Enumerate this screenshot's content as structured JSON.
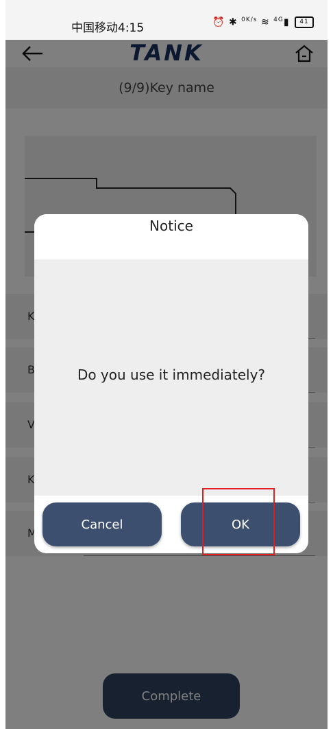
{
  "status_bar": {
    "carrier_time": "中国移动4:15",
    "net_speed_value": "0",
    "net_speed_unit": "K/s",
    "signal": "4G",
    "battery": "41"
  },
  "header": {
    "logo": "TANK",
    "back_icon": "back-arrow-icon",
    "home_icon": "home-icon"
  },
  "page": {
    "subtitle": "(9/9)Key name"
  },
  "rows": [
    {
      "label": "K"
    },
    {
      "label": "B"
    },
    {
      "label": "V"
    },
    {
      "label": "K"
    },
    {
      "label": "M"
    }
  ],
  "complete_label": "Complete",
  "dialog": {
    "title": "Notice",
    "message": "Do you use it immediately?",
    "cancel_label": "Cancel",
    "ok_label": "OK"
  },
  "colors": {
    "brand": "#18315e",
    "button": "#3d4f6e",
    "highlight": "#e02020"
  }
}
